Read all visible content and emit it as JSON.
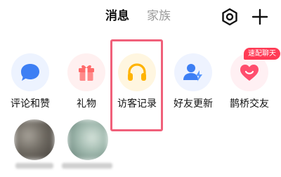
{
  "header": {
    "tabs": [
      {
        "label": "消息",
        "active": true
      },
      {
        "label": "家族",
        "active": false
      }
    ],
    "settings_icon": "settings-icon",
    "add_icon": "plus-icon"
  },
  "quick_actions": [
    {
      "label": "评论和赞",
      "icon": "comment-bubble-icon",
      "bg": "#edf3ff",
      "color": "#3d7ff4"
    },
    {
      "label": "礼物",
      "icon": "gift-icon",
      "bg": "#fff0f0",
      "color": "#ff6b6b"
    },
    {
      "label": "访客记录",
      "icon": "headphones-icon",
      "bg": "#fff6e0",
      "color": "#ffb300",
      "highlighted": true
    },
    {
      "label": "好友更新",
      "icon": "friend-update-icon",
      "bg": "#eef3ff",
      "color": "#3d7ff4"
    },
    {
      "label": "鹊桥交友",
      "icon": "heart-icon",
      "bg": "#fff0f3",
      "color": "#ff4d6d",
      "badge": "速配聊天"
    }
  ],
  "colors": {
    "accent_pink": "#ff3b55",
    "highlight_border": "#f0607a"
  }
}
